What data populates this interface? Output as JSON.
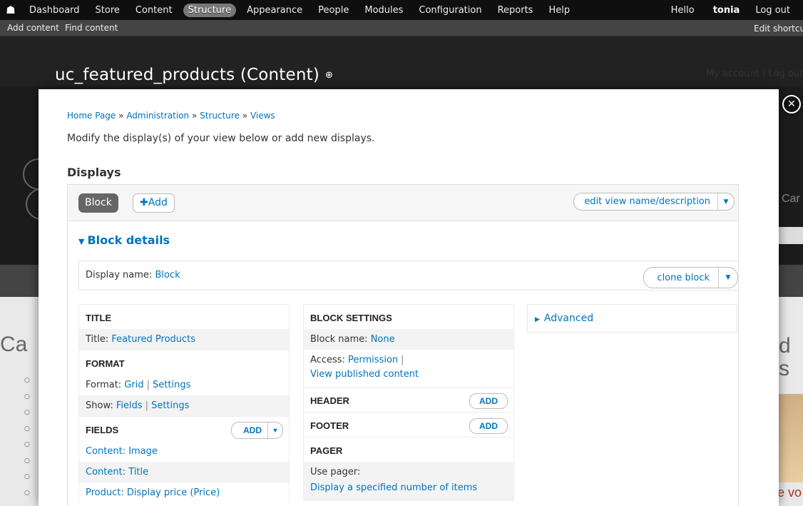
{
  "toolbar": {
    "home_icon": "home-icon",
    "items": [
      "Dashboard",
      "Store",
      "Content",
      "Structure",
      "Appearance",
      "People",
      "Modules",
      "Configuration",
      "Reports",
      "Help"
    ],
    "active_item": "Structure",
    "hello": "Hello",
    "username": "tonia",
    "logout": "Log out"
  },
  "shortcuts": {
    "items": [
      "Add content",
      "Find content"
    ],
    "edit_shortcuts": "Edit shortcuts"
  },
  "overlay": {
    "title": "uc_featured_products (Content)",
    "add_shortcut_icon": "plus-circle-icon",
    "secondary_links": "My account | Log out",
    "close_icon": "close-icon"
  },
  "background": {
    "left_letters": "Ca",
    "right_letter_d": "d",
    "right_letter_s": "s",
    "right_bottom": "e vo",
    "right_band": "Car"
  },
  "page": {
    "breadcrumb": [
      "Home Page",
      "Administration",
      "Structure",
      "Views"
    ],
    "breadcrumb_sep": "»",
    "help": "Modify the display(s) of your view below or add new displays.",
    "displays_heading": "Displays"
  },
  "tabs": {
    "block": "Block",
    "add": "Add",
    "add_icon": "plus-icon",
    "edit_view": "edit view name/description"
  },
  "details": {
    "heading": "Block details",
    "display_name_label": "Display name:",
    "display_name_value": "Block",
    "clone": "clone block"
  },
  "col1": {
    "title_heading": "Title",
    "title_label": "Title:",
    "title_value": "Featured Products",
    "format_heading": "Format",
    "format_label": "Format:",
    "format_value": "Grid",
    "format_settings": "Settings",
    "show_label": "Show:",
    "show_value": "Fields",
    "show_settings": "Settings",
    "fields_heading": "Fields",
    "fields_add": "add",
    "fields": [
      "Content: Image",
      "Content: Title",
      "Product: Display price (Price)"
    ]
  },
  "col2": {
    "block_settings_heading": "Block Settings",
    "block_name_label": "Block name:",
    "block_name_value": "None",
    "access_label": "Access:",
    "access_value": "Permission",
    "access_perm": "View published content",
    "header_heading": "Header",
    "header_add": "add",
    "footer_heading": "Footer",
    "footer_add": "add",
    "pager_heading": "Pager",
    "use_pager_label": "Use pager:",
    "use_pager_value": "Display a specified number of items"
  },
  "col3": {
    "advanced": "Advanced"
  }
}
